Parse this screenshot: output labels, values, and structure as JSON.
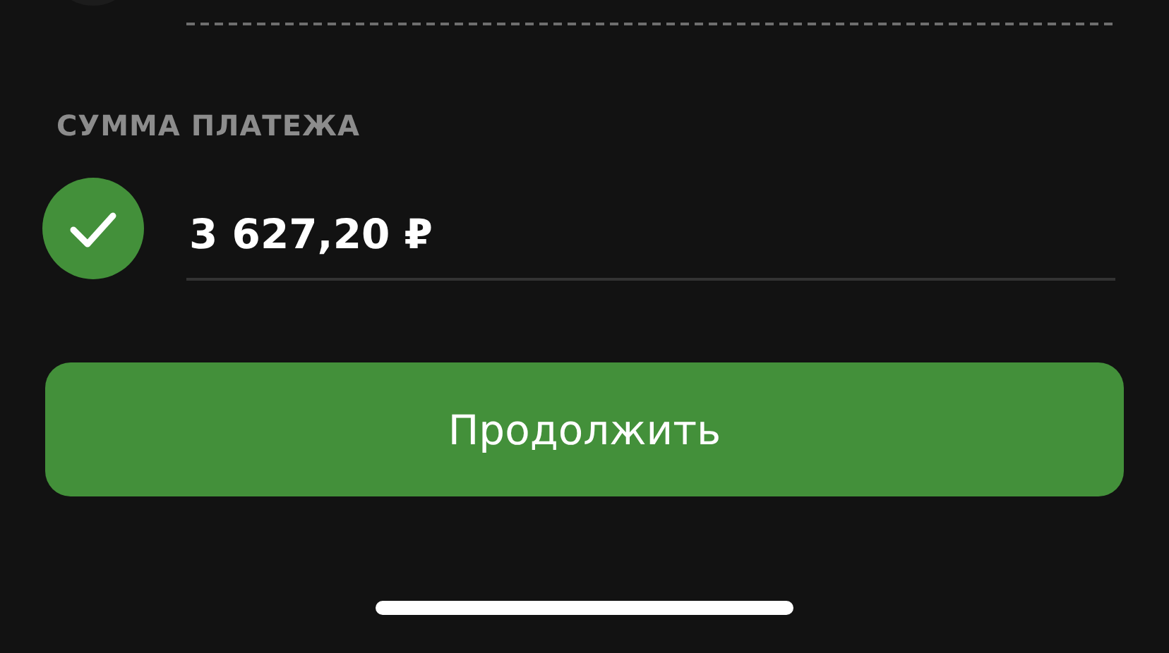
{
  "payment_amount": {
    "label": "СУММА ПЛАТЕЖА",
    "value": "3 627,20 ₽",
    "valid": true
  },
  "continue_button": {
    "label": "Продолжить"
  }
}
